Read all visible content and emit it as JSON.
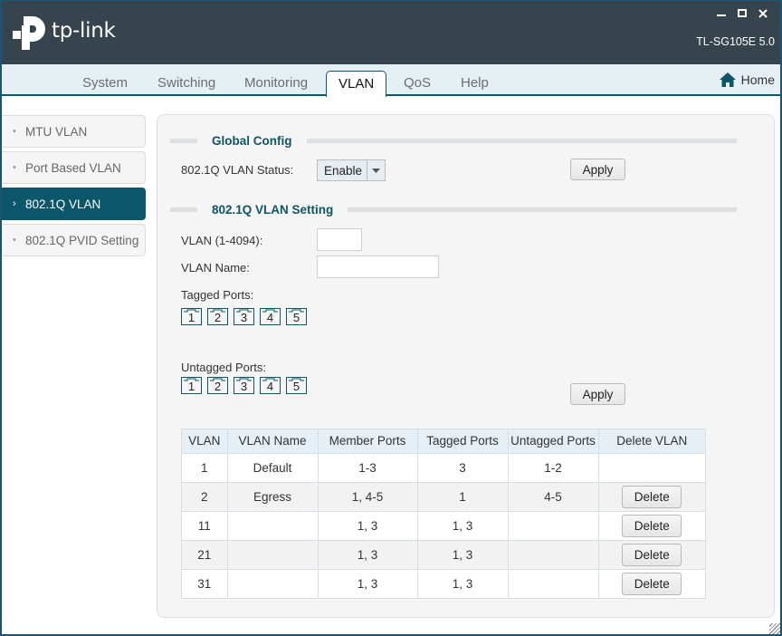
{
  "header": {
    "brand": "tp-link",
    "model": "TL-SG105E 5.0",
    "window_controls": [
      "minimize",
      "maximize",
      "close"
    ]
  },
  "nav": {
    "tabs": [
      {
        "label": "System",
        "active": false
      },
      {
        "label": "Switching",
        "active": false
      },
      {
        "label": "Monitoring",
        "active": false
      },
      {
        "label": "VLAN",
        "active": true
      },
      {
        "label": "QoS",
        "active": false
      },
      {
        "label": "Help",
        "active": false
      }
    ],
    "home_label": "Home"
  },
  "sidebar": {
    "items": [
      {
        "label": "MTU VLAN",
        "active": false
      },
      {
        "label": "Port Based VLAN",
        "active": false
      },
      {
        "label": "802.1Q VLAN",
        "active": true
      },
      {
        "label": "802.1Q PVID Setting",
        "active": false
      }
    ]
  },
  "global_config": {
    "title": "Global Config",
    "status_label": "802.1Q VLAN Status:",
    "status_value": "Enable",
    "apply_label": "Apply"
  },
  "vlan_setting": {
    "title": "802.1Q VLAN Setting",
    "vlan_id_label": "VLAN (1-4094):",
    "vlan_id_value": "",
    "vlan_name_label": "VLAN Name:",
    "vlan_name_value": "",
    "tagged_label": "Tagged Ports:",
    "untagged_label": "Untagged Ports:",
    "ports": [
      "1",
      "2",
      "3",
      "4",
      "5"
    ],
    "apply_label": "Apply"
  },
  "table": {
    "headers": [
      "VLAN",
      "VLAN Name",
      "Member Ports",
      "Tagged Ports",
      "Untagged Ports",
      "Delete VLAN"
    ],
    "delete_label": "Delete",
    "rows": [
      {
        "vlan": "1",
        "name": "Default",
        "member": "1-3",
        "tagged": "3",
        "untagged": "1-2",
        "deletable": false
      },
      {
        "vlan": "2",
        "name": "Egress",
        "member": "1, 4-5",
        "tagged": "1",
        "untagged": "4-5",
        "deletable": true
      },
      {
        "vlan": "11",
        "name": "",
        "member": "1, 3",
        "tagged": "1, 3",
        "untagged": "",
        "deletable": true
      },
      {
        "vlan": "21",
        "name": "",
        "member": "1, 3",
        "tagged": "1, 3",
        "untagged": "",
        "deletable": true
      },
      {
        "vlan": "31",
        "name": "",
        "member": "1, 3",
        "tagged": "1, 3",
        "untagged": "",
        "deletable": true
      }
    ]
  },
  "colors": {
    "header_bg": "#35444d",
    "accent": "#0b5668",
    "nav_bg": "#e6eff4"
  }
}
